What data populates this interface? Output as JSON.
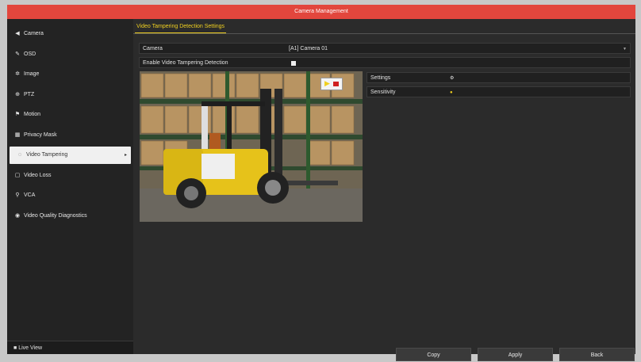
{
  "window": {
    "title": "Camera Management"
  },
  "sidebar": {
    "items": [
      {
        "label": "Camera",
        "icon": "camera-icon",
        "glyph": "◀"
      },
      {
        "label": "OSD",
        "icon": "pen-icon",
        "glyph": "✎"
      },
      {
        "label": "Image",
        "icon": "image-icon",
        "glyph": "✲"
      },
      {
        "label": "PTZ",
        "icon": "ptz-icon",
        "glyph": "⊕"
      },
      {
        "label": "Motion",
        "icon": "motion-icon",
        "glyph": "⚑"
      },
      {
        "label": "Privacy Mask",
        "icon": "mask-icon",
        "glyph": "▦"
      },
      {
        "label": "Video Tampering",
        "icon": "tampering-icon",
        "glyph": "◌",
        "active": true
      },
      {
        "label": "Video Loss",
        "icon": "video-loss-icon",
        "glyph": "▢"
      },
      {
        "label": "VCA",
        "icon": "vca-icon",
        "glyph": "⚲"
      },
      {
        "label": "Video Quality Diagnostics",
        "icon": "diagnostics-icon",
        "glyph": "◉"
      }
    ],
    "live_view": "Live View"
  },
  "main": {
    "tab": "Video Tampering Detection Settings",
    "camera_label": "Camera",
    "camera_value": "[A1] Camera 01",
    "enable_label": "Enable Video Tampering Detection",
    "enable_checked": true,
    "settings_label": "Settings",
    "sensitivity_label": "Sensitivity"
  },
  "buttons": {
    "copy": "Copy",
    "apply": "Apply",
    "back": "Back"
  },
  "colors": {
    "titlebar": "#e2463d",
    "accent": "#f0d020"
  }
}
